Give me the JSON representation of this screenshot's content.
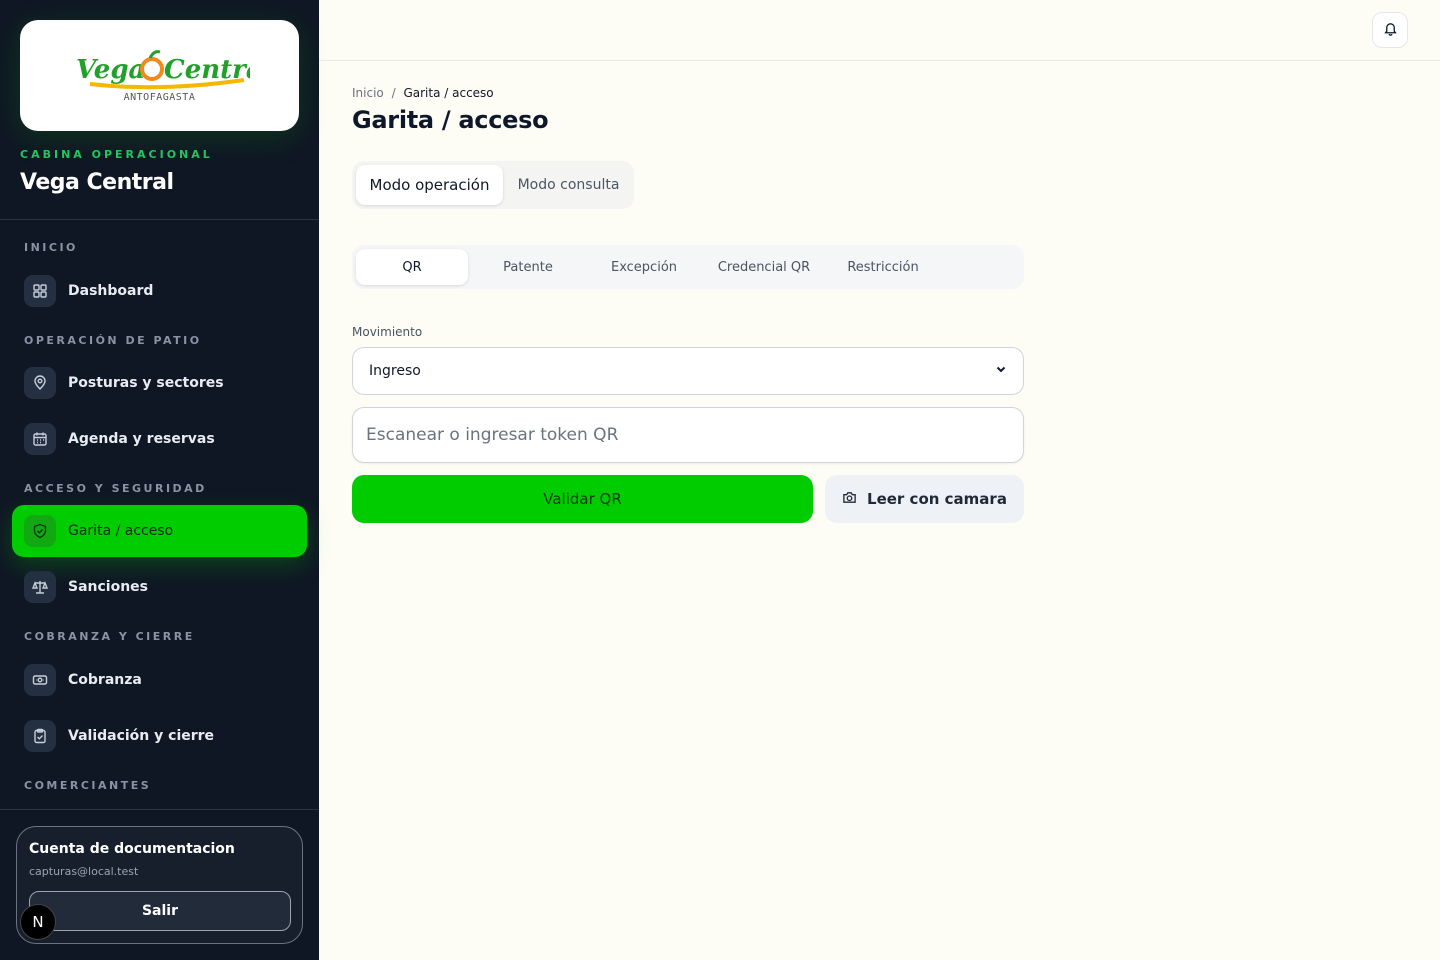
{
  "brand": {
    "logo_text": "Vega Central",
    "logo_subtitle": "ANTOFAGASTA",
    "kicker": "CABINA OPERACIONAL",
    "title": "Vega Central",
    "accent_color": "#00cc00"
  },
  "sidebar": {
    "sections": [
      {
        "label": "INICIO",
        "items": [
          {
            "label": "Dashboard",
            "icon": "grid-icon"
          }
        ]
      },
      {
        "label": "OPERACIÓN DE PATIO",
        "items": [
          {
            "label": "Posturas y sectores",
            "icon": "map-pin-icon"
          },
          {
            "label": "Agenda y reservas",
            "icon": "calendar-icon"
          }
        ]
      },
      {
        "label": "ACCESO Y SEGURIDAD",
        "items": [
          {
            "label": "Garita / acceso",
            "icon": "shield-icon",
            "active": true
          },
          {
            "label": "Sanciones",
            "icon": "scale-icon"
          }
        ]
      },
      {
        "label": "COBRANZA Y CIERRE",
        "items": [
          {
            "label": "Cobranza",
            "icon": "banknote-icon"
          },
          {
            "label": "Validación y cierre",
            "icon": "clipboard-check-icon"
          }
        ]
      },
      {
        "label": "COMERCIANTES",
        "items": []
      }
    ]
  },
  "account": {
    "name": "Cuenta de documentacion",
    "email": "capturas@local.test",
    "logout_label": "Salir",
    "badge": "N"
  },
  "header": {
    "breadcrumb_root": "Inicio",
    "breadcrumb_separator": "/",
    "breadcrumb_current": "Garita / acceso",
    "title": "Garita / acceso",
    "notifications_icon": "bell-icon"
  },
  "mode_tabs": [
    {
      "label": "Modo operación",
      "active": true
    },
    {
      "label": "Modo consulta",
      "active": false
    }
  ],
  "sub_tabs": [
    {
      "label": "QR",
      "active": true
    },
    {
      "label": "Patente",
      "active": false
    },
    {
      "label": "Excepción",
      "active": false
    },
    {
      "label": "Credencial QR",
      "active": false
    },
    {
      "label": "Restricción",
      "active": false
    }
  ],
  "form": {
    "movement_label": "Movimiento",
    "movement_value": "Ingreso",
    "token_placeholder": "Escanear o ingresar token QR",
    "token_value": "",
    "validate_label": "Validar QR",
    "camera_label": "Leer con camara",
    "camera_icon": "camera-icon"
  }
}
